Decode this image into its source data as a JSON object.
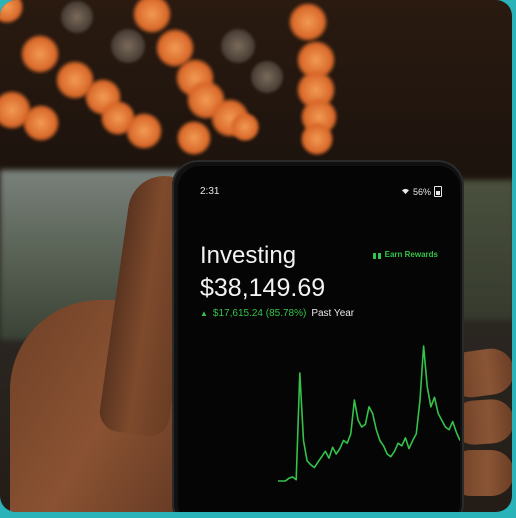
{
  "scene": {
    "description_colors": {
      "accent_green": "#35c24a",
      "frame_border": "#2ab3b8"
    }
  },
  "phone": {
    "status": {
      "time": "2:31",
      "battery": "56%"
    },
    "title": "Investing",
    "rewards_label": "Earn Rewards",
    "balance": "$38,149.69",
    "change_value": "$17,615.24 (85.78%)",
    "period": "Past Year",
    "icons": [
      "wifi-icon",
      "battery-icon",
      "gift-icon",
      "up-arrow-icon"
    ]
  },
  "chart_data": {
    "type": "line",
    "series": [
      {
        "values": [
          0,
          0,
          0,
          2,
          3,
          1,
          80,
          30,
          15,
          12,
          10,
          14,
          18,
          22,
          17,
          25,
          20,
          24,
          30,
          28,
          35,
          60,
          45,
          40,
          42,
          55,
          50,
          38,
          30,
          26,
          20,
          18,
          22,
          28,
          26,
          32,
          24,
          30,
          35,
          60,
          100,
          70,
          55,
          62,
          50,
          45,
          40,
          38,
          44,
          36,
          30
        ]
      }
    ]
  }
}
